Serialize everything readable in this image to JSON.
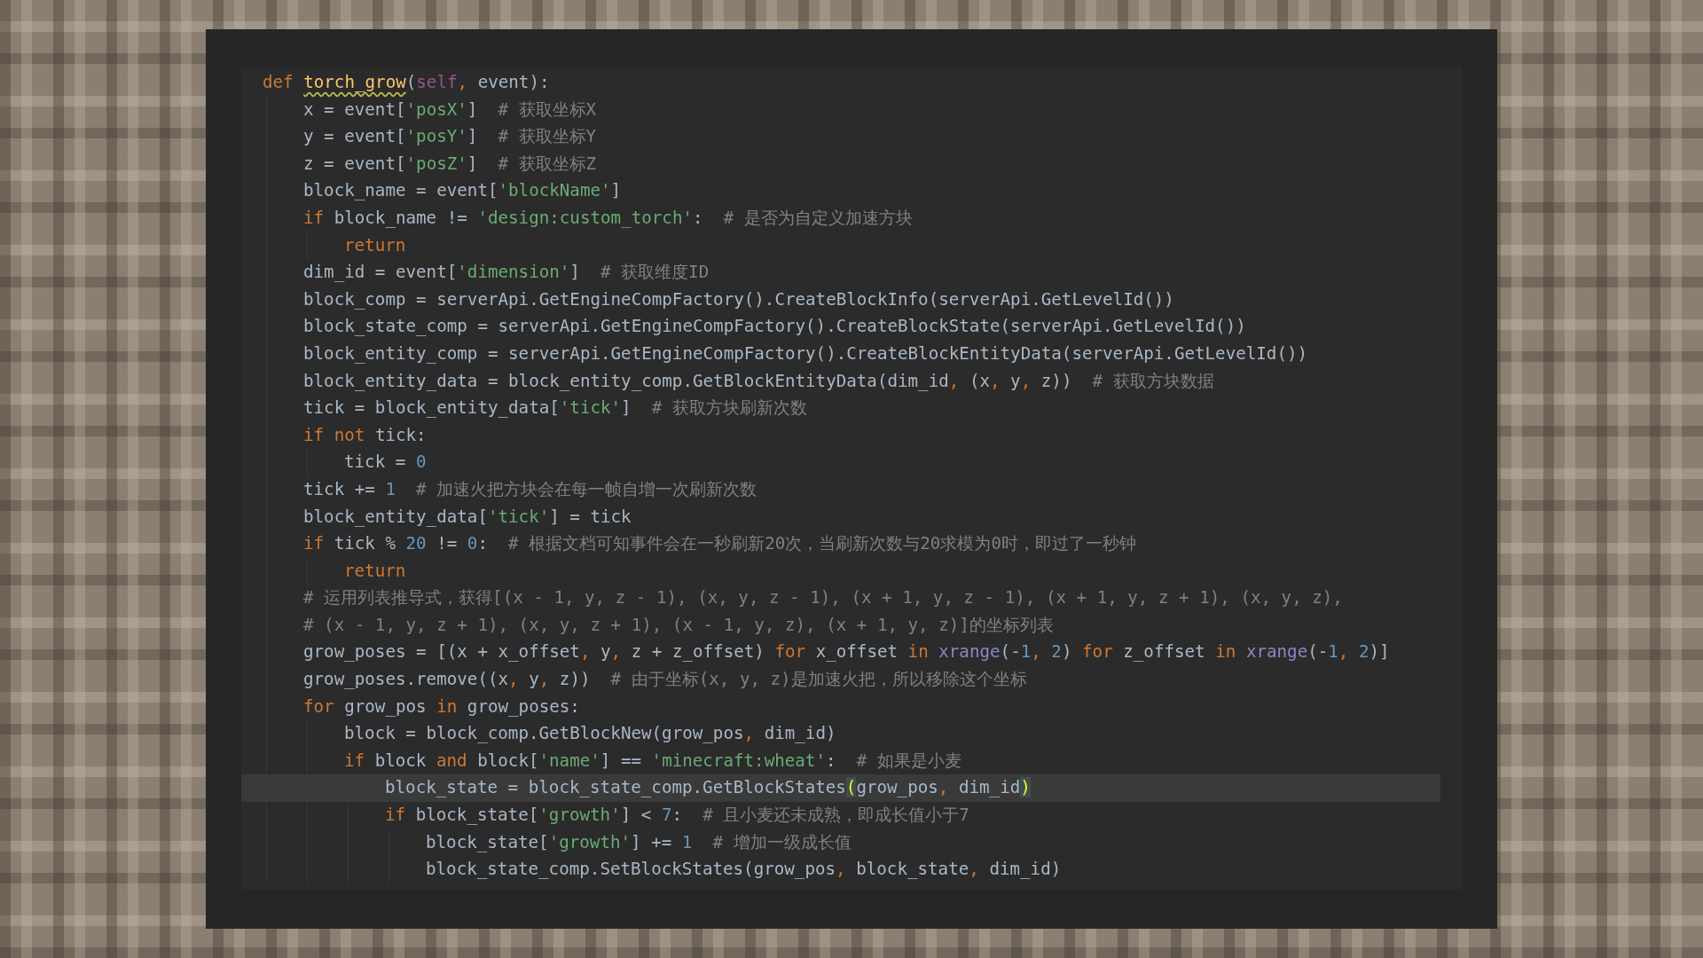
{
  "lines": [
    {
      "current": false,
      "tokens": [
        {
          "kind": "keyword",
          "text": "def "
        },
        {
          "kind": "function",
          "text": "torch_grow"
        },
        {
          "kind": "plain",
          "text": "("
        },
        {
          "kind": "self",
          "text": "self"
        },
        {
          "kind": "comma",
          "text": ", "
        },
        {
          "kind": "plain",
          "text": "event):"
        }
      ],
      "children": [
        {
          "current": false,
          "tokens": [
            {
              "kind": "plain",
              "text": "x = event["
            },
            {
              "kind": "string",
              "text": "'posX'"
            },
            {
              "kind": "plain",
              "text": "]  "
            },
            {
              "kind": "comment",
              "text": "# 获取坐标X"
            }
          ]
        },
        {
          "current": false,
          "tokens": [
            {
              "kind": "plain",
              "text": "y = event["
            },
            {
              "kind": "string",
              "text": "'posY'"
            },
            {
              "kind": "plain",
              "text": "]  "
            },
            {
              "kind": "comment",
              "text": "# 获取坐标Y"
            }
          ]
        },
        {
          "current": false,
          "tokens": [
            {
              "kind": "plain",
              "text": "z = event["
            },
            {
              "kind": "string",
              "text": "'posZ'"
            },
            {
              "kind": "plain",
              "text": "]  "
            },
            {
              "kind": "comment",
              "text": "# 获取坐标Z"
            }
          ]
        },
        {
          "current": false,
          "tokens": [
            {
              "kind": "plain",
              "text": "block_name = event["
            },
            {
              "kind": "string",
              "text": "'blockName'"
            },
            {
              "kind": "plain",
              "text": "]"
            }
          ]
        },
        {
          "current": false,
          "tokens": [
            {
              "kind": "keyword",
              "text": "if "
            },
            {
              "kind": "plain",
              "text": "block_name != "
            },
            {
              "kind": "string",
              "text": "'design:custom_torch'"
            },
            {
              "kind": "plain",
              "text": ":  "
            },
            {
              "kind": "comment",
              "text": "# 是否为自定义加速方块"
            }
          ],
          "children": [
            {
              "current": false,
              "tokens": [
                {
                  "kind": "keyword",
                  "text": "return"
                }
              ]
            }
          ]
        },
        {
          "current": false,
          "tokens": [
            {
              "kind": "plain",
              "text": "dim_id = event["
            },
            {
              "kind": "string",
              "text": "'dimension'"
            },
            {
              "kind": "plain",
              "text": "]  "
            },
            {
              "kind": "comment",
              "text": "# 获取维度ID"
            }
          ]
        },
        {
          "current": false,
          "tokens": [
            {
              "kind": "plain",
              "text": "block_comp = serverApi.GetEngineCompFactory().CreateBlockInfo(serverApi.GetLevelId())"
            }
          ]
        },
        {
          "current": false,
          "tokens": [
            {
              "kind": "plain",
              "text": "block_state_comp = serverApi.GetEngineCompFactory().CreateBlockState(serverApi.GetLevelId())"
            }
          ]
        },
        {
          "current": false,
          "tokens": [
            {
              "kind": "plain",
              "text": "block_entity_comp = serverApi.GetEngineCompFactory().CreateBlockEntityData(serverApi.GetLevelId())"
            }
          ]
        },
        {
          "current": false,
          "tokens": [
            {
              "kind": "plain",
              "text": "block_entity_data = block_entity_comp.GetBlockEntityData(dim_id"
            },
            {
              "kind": "comma",
              "text": ", "
            },
            {
              "kind": "plain",
              "text": "(x"
            },
            {
              "kind": "comma",
              "text": ", "
            },
            {
              "kind": "plain",
              "text": "y"
            },
            {
              "kind": "comma",
              "text": ", "
            },
            {
              "kind": "plain",
              "text": "z))  "
            },
            {
              "kind": "comment",
              "text": "# 获取方块数据"
            }
          ]
        },
        {
          "current": false,
          "tokens": [
            {
              "kind": "plain",
              "text": "tick = block_entity_data["
            },
            {
              "kind": "string",
              "text": "'tick'"
            },
            {
              "kind": "plain",
              "text": "]  "
            },
            {
              "kind": "comment",
              "text": "# 获取方块刷新次数"
            }
          ]
        },
        {
          "current": false,
          "tokens": [
            {
              "kind": "keyword",
              "text": "if "
            },
            {
              "kind": "keyword",
              "text": "not "
            },
            {
              "kind": "plain",
              "text": "tick:"
            }
          ],
          "children": [
            {
              "current": false,
              "tokens": [
                {
                  "kind": "plain",
                  "text": "tick = "
                },
                {
                  "kind": "number",
                  "text": "0"
                }
              ]
            }
          ]
        },
        {
          "current": false,
          "tokens": [
            {
              "kind": "plain",
              "text": "tick += "
            },
            {
              "kind": "number",
              "text": "1"
            },
            {
              "kind": "comment",
              "text": "  # 加速火把方块会在每一帧自增一次刷新次数"
            }
          ]
        },
        {
          "current": false,
          "tokens": [
            {
              "kind": "plain",
              "text": "block_entity_data["
            },
            {
              "kind": "string",
              "text": "'tick'"
            },
            {
              "kind": "plain",
              "text": "] = tick"
            }
          ]
        },
        {
          "current": false,
          "tokens": [
            {
              "kind": "keyword",
              "text": "if "
            },
            {
              "kind": "plain",
              "text": "tick % "
            },
            {
              "kind": "number",
              "text": "20"
            },
            {
              "kind": "plain",
              "text": " != "
            },
            {
              "kind": "number",
              "text": "0"
            },
            {
              "kind": "plain",
              "text": ":  "
            },
            {
              "kind": "comment",
              "text": "# 根据文档可知事件会在一秒刷新20次，当刷新次数与20求模为0时，即过了一秒钟"
            }
          ],
          "children": [
            {
              "current": false,
              "tokens": [
                {
                  "kind": "keyword",
                  "text": "return"
                }
              ]
            }
          ]
        },
        {
          "current": false,
          "tokens": [
            {
              "kind": "comment",
              "text": "# 运用列表推导式，获得[(x - 1, y, z - 1), (x, y, z - 1), (x + 1, y, z - 1), (x + 1, y, z + 1), (x, y, z),"
            }
          ]
        },
        {
          "current": false,
          "tokens": [
            {
              "kind": "comment",
              "text": "# (x - 1, y, z + 1), (x, y, z + 1), (x - 1, y, z), (x + 1, y, z)]的坐标列表"
            }
          ]
        },
        {
          "current": false,
          "tokens": [
            {
              "kind": "plain",
              "text": "grow_poses = [(x + x_offset"
            },
            {
              "kind": "comma",
              "text": ", "
            },
            {
              "kind": "plain",
              "text": "y"
            },
            {
              "kind": "comma",
              "text": ", "
            },
            {
              "kind": "plain",
              "text": "z + z_offset) "
            },
            {
              "kind": "keyword",
              "text": "for "
            },
            {
              "kind": "plain",
              "text": "x_offset "
            },
            {
              "kind": "keyword",
              "text": "in "
            },
            {
              "kind": "builtin",
              "text": "xrange"
            },
            {
              "kind": "plain",
              "text": "(-"
            },
            {
              "kind": "number",
              "text": "1"
            },
            {
              "kind": "comma",
              "text": ", "
            },
            {
              "kind": "number",
              "text": "2"
            },
            {
              "kind": "plain",
              "text": ") "
            },
            {
              "kind": "keyword",
              "text": "for "
            },
            {
              "kind": "plain",
              "text": "z_offset "
            },
            {
              "kind": "keyword",
              "text": "in "
            },
            {
              "kind": "builtin",
              "text": "xrange"
            },
            {
              "kind": "plain",
              "text": "(-"
            },
            {
              "kind": "number",
              "text": "1"
            },
            {
              "kind": "comma",
              "text": ", "
            },
            {
              "kind": "number",
              "text": "2"
            },
            {
              "kind": "plain",
              "text": ")]"
            }
          ]
        },
        {
          "current": false,
          "tokens": [
            {
              "kind": "plain",
              "text": "grow_poses.remove((x"
            },
            {
              "kind": "comma",
              "text": ", "
            },
            {
              "kind": "plain",
              "text": "y"
            },
            {
              "kind": "comma",
              "text": ", "
            },
            {
              "kind": "plain",
              "text": "z))  "
            },
            {
              "kind": "comment",
              "text": "# 由于坐标(x, y, z)是加速火把，所以移除这个坐标"
            }
          ]
        },
        {
          "current": false,
          "tokens": [
            {
              "kind": "keyword",
              "text": "for "
            },
            {
              "kind": "plain",
              "text": "grow_pos "
            },
            {
              "kind": "keyword",
              "text": "in "
            },
            {
              "kind": "plain",
              "text": "grow_poses:"
            }
          ],
          "children": [
            {
              "current": false,
              "tokens": [
                {
                  "kind": "plain",
                  "text": "block = block_comp.GetBlockNew(grow_pos"
                },
                {
                  "kind": "comma",
                  "text": ", "
                },
                {
                  "kind": "plain",
                  "text": "dim_id)"
                }
              ]
            },
            {
              "current": false,
              "tokens": [
                {
                  "kind": "keyword",
                  "text": "if "
                },
                {
                  "kind": "plain",
                  "text": "block "
                },
                {
                  "kind": "keyword",
                  "text": "and "
                },
                {
                  "kind": "plain",
                  "text": "block["
                },
                {
                  "kind": "string",
                  "text": "'name'"
                },
                {
                  "kind": "plain",
                  "text": "] == "
                },
                {
                  "kind": "string",
                  "text": "'minecraft:wheat'"
                },
                {
                  "kind": "plain",
                  "text": ":  "
                },
                {
                  "kind": "comment",
                  "text": "# 如果是小麦"
                }
              ],
              "children": [
                {
                  "current": true,
                  "tokens": [
                    {
                      "kind": "plain",
                      "text": "block_state = block_state_comp.GetBlockStates"
                    },
                    {
                      "kind": "match",
                      "text": "("
                    },
                    {
                      "kind": "plain",
                      "text": "grow_pos"
                    },
                    {
                      "kind": "comma",
                      "text": ", "
                    },
                    {
                      "kind": "plain",
                      "text": "dim_id"
                    },
                    {
                      "kind": "match",
                      "text": ")"
                    }
                  ]
                },
                {
                  "current": false,
                  "tokens": [
                    {
                      "kind": "keyword",
                      "text": "if "
                    },
                    {
                      "kind": "plain",
                      "text": "block_state["
                    },
                    {
                      "kind": "string",
                      "text": "'growth'"
                    },
                    {
                      "kind": "plain",
                      "text": "] < "
                    },
                    {
                      "kind": "number",
                      "text": "7"
                    },
                    {
                      "kind": "plain",
                      "text": ":  "
                    },
                    {
                      "kind": "comment",
                      "text": "# 且小麦还未成熟，即成长值小于7"
                    }
                  ],
                  "children": [
                    {
                      "current": false,
                      "tokens": [
                        {
                          "kind": "plain",
                          "text": "block_state["
                        },
                        {
                          "kind": "string",
                          "text": "'growth'"
                        },
                        {
                          "kind": "plain",
                          "text": "] += "
                        },
                        {
                          "kind": "number",
                          "text": "1"
                        },
                        {
                          "kind": "comment",
                          "text": "  # 增加一级成长值"
                        }
                      ]
                    },
                    {
                      "current": false,
                      "tokens": [
                        {
                          "kind": "plain",
                          "text": "block_state_comp.SetBlockStates(grow_pos"
                        },
                        {
                          "kind": "comma",
                          "text": ", "
                        },
                        {
                          "kind": "plain",
                          "text": "block_state"
                        },
                        {
                          "kind": "comma",
                          "text": ", "
                        },
                        {
                          "kind": "plain",
                          "text": "dim_id)"
                        }
                      ]
                    }
                  ]
                }
              ]
            }
          ]
        }
      ]
    }
  ]
}
